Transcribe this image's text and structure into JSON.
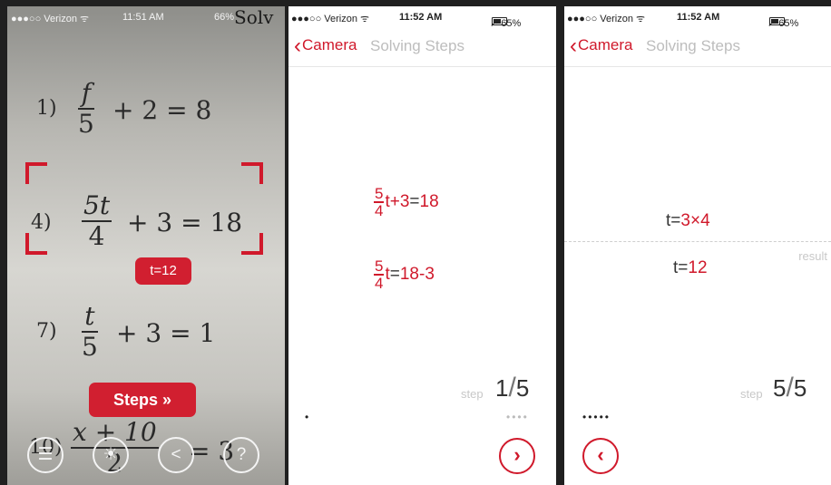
{
  "phone1": {
    "status": {
      "carrier": "●●●○○ Verizon ᯤ",
      "time": "11:51 AM",
      "battery": "66%",
      "paper_corner": "Solv"
    },
    "problems": [
      {
        "num": "1)",
        "numerator": "f",
        "denominator": "5",
        "rest": "+ 2 = 8"
      },
      {
        "num": "4)",
        "numerator": "5t",
        "denominator": "4",
        "rest": "+ 3 = 18"
      },
      {
        "num": "7)",
        "numerator": "t",
        "denominator": "5",
        "rest": "+ 3 = 1"
      },
      {
        "num": "10)",
        "numerator": "x + 10",
        "denominator": "2",
        "rest": "= 3"
      }
    ],
    "answer": "t=12",
    "steps_button": "Steps »",
    "icons": [
      "menu-icon",
      "brightness-icon",
      "back-icon",
      "help-icon"
    ],
    "icon_glyphs": {
      "menu": "☰",
      "brightness": "☀",
      "back": "<",
      "help": "?"
    }
  },
  "phone2": {
    "status": {
      "carrier": "●●●○○ Verizon ᯤ",
      "time": "11:52 AM",
      "battery": "➚ 65%"
    },
    "nav": {
      "back": "Camera",
      "title": "Solving Steps"
    },
    "eq1": {
      "num": "5",
      "den": "4",
      "a": "t",
      "b": "+3",
      "c": "=",
      "d": "18"
    },
    "eq2": {
      "num": "5",
      "den": "4",
      "a": "t",
      "b": "=",
      "c": "18",
      "d": "-3"
    },
    "step_label": "step",
    "step_current": "1",
    "step_total": "5",
    "dots_left": "•",
    "dots_right": "••••",
    "next": "›"
  },
  "phone3": {
    "status": {
      "carrier": "●●●○○ Verizon ᯤ",
      "time": "11:52 AM",
      "battery": "➚ 65%"
    },
    "nav": {
      "back": "Camera",
      "title": "Solving Steps"
    },
    "eq1": {
      "a": "t",
      "b": "=",
      "c": "3",
      "d": "×",
      "e": "4"
    },
    "eq2": {
      "a": "t",
      "b": "=",
      "c": "12"
    },
    "result_label": "result",
    "step_label": "step",
    "step_current": "5",
    "step_total": "5",
    "dots_left": "•••••",
    "prev": "‹"
  },
  "colors": {
    "accent": "#d0192b",
    "badge": "#d11f30"
  }
}
